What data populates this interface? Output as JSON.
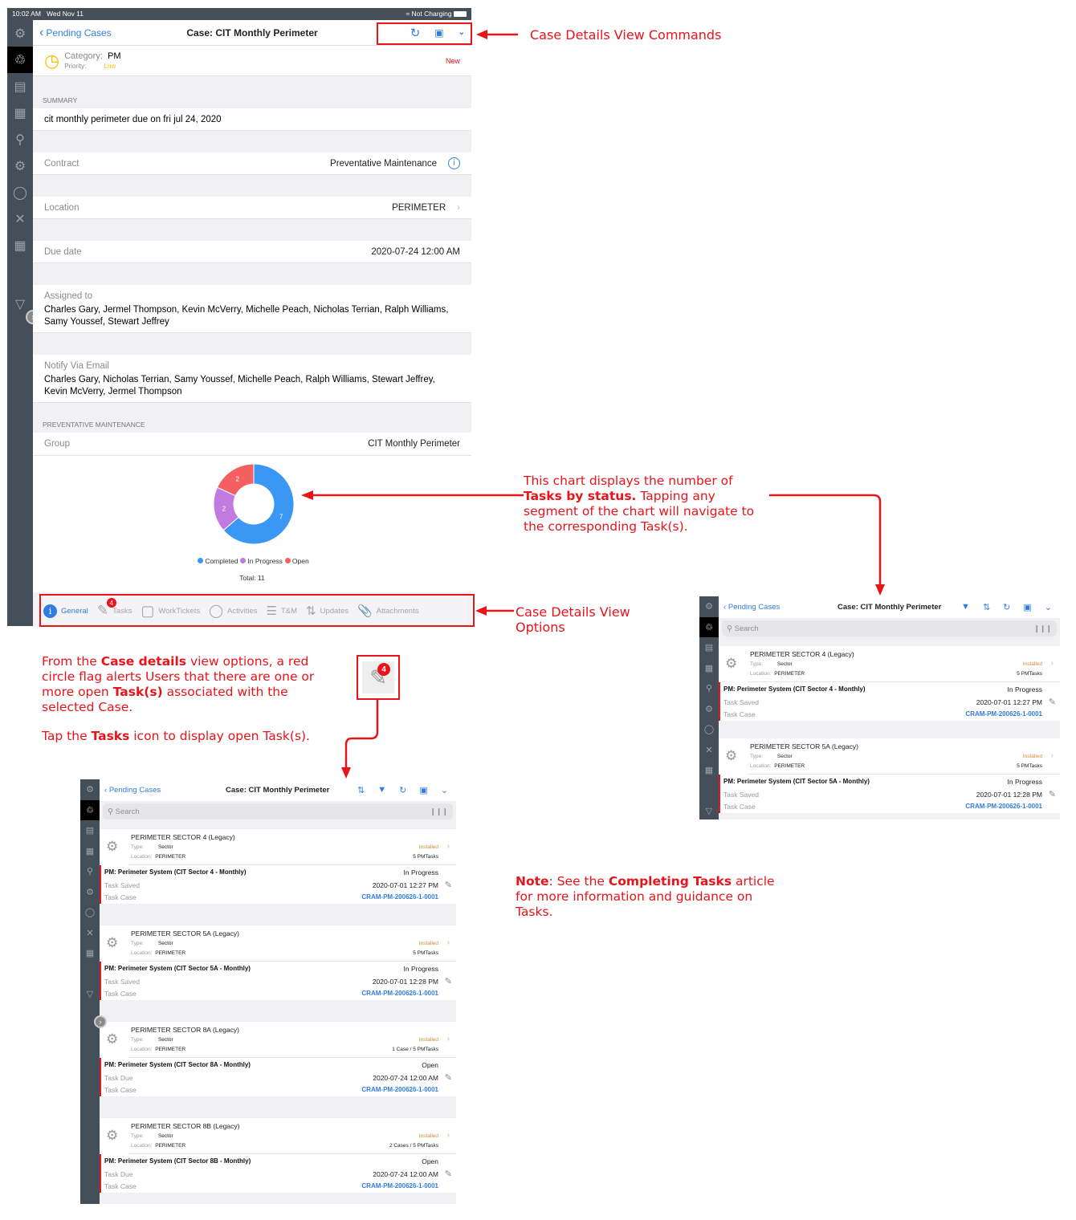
{
  "status_bar": {
    "time": "10:02 AM",
    "date": "Wed Nov 11",
    "battery": "Not Charging"
  },
  "nav": {
    "back_label": "Pending Cases",
    "title": "Case: CIT Monthly Perimeter"
  },
  "header": {
    "category_label": "Category:",
    "category_value": "PM",
    "priority_label": "Priority:",
    "priority_value": "Low",
    "status": "New"
  },
  "summary": {
    "section_label": "SUMMARY",
    "text": "cit monthly perimeter due on fri jul 24, 2020"
  },
  "fields": {
    "contract_label": "Contract",
    "contract_value": "Preventative Maintenance",
    "location_label": "Location",
    "location_value": "PERIMETER",
    "due_label": "Due date",
    "due_value": "2020-07-24 12:00 AM",
    "assigned_label": "Assigned to",
    "assigned_value": "Charles Gary, Jermel Thompson, Kevin McVerry, Michelle Peach, Nicholas Terrian, Ralph Williams, Samy Youssef, Stewart Jeffrey",
    "notify_label": "Notify Via Email",
    "notify_value": "Charles Gary, Nicholas Terrian, Samy Youssef, Michelle Peach, Ralph Williams, Stewart Jeffrey, Kevin McVerry, Jermel Thompson"
  },
  "pm": {
    "section_label": "PREVENTATIVE MAINTENANCE",
    "group_label": "Group",
    "group_value": "CIT Monthly Perimeter"
  },
  "chart_data": {
    "type": "pie",
    "title": "Tasks by status",
    "categories": [
      "Completed",
      "In Progress",
      "Open"
    ],
    "values": [
      7,
      2,
      2
    ],
    "colors": [
      "#3b97f4",
      "#c07ae0",
      "#f46060"
    ],
    "legend": "bottom",
    "total_label": "Total: 11"
  },
  "tabs": [
    {
      "label": "General",
      "selected": true
    },
    {
      "label": "Tasks",
      "badge": "4"
    },
    {
      "label": "WorkTickets"
    },
    {
      "label": "Activities"
    },
    {
      "label": "T&M"
    },
    {
      "label": "Updates"
    },
    {
      "label": "Attachments"
    }
  ],
  "annotations": {
    "commands": "Case Details View Commands",
    "options": "Case Details View Options",
    "chart_pre": "This chart displays the number of ",
    "chart_bold": "Tasks by status.",
    "chart_post": " Tapping any segment of the chart will navigate to the corresponding Task(s).",
    "flag_1": "From the ",
    "flag_b1": "Case details",
    "flag_2": " view options, a red circle flag alerts Users that there are one or more open ",
    "flag_b2": "Task(s)",
    "flag_3": " associated with the selected Case.",
    "tap_1": "Tap the ",
    "tap_b": "Tasks",
    "tap_2": " icon to display open Task(s).",
    "note_b": "Note",
    "note_1": ": See the ",
    "note_b2": "Completing Tasks",
    "note_2": " article for more information and guidance on Tasks.",
    "badge": "4"
  },
  "task_list": {
    "search_placeholder": "Search",
    "items": [
      {
        "asset": "PERIMETER SECTOR 4 (Legacy)",
        "type_label": "Type:",
        "type": "Sector",
        "loc_label": "Location:",
        "location": "PERIMETER",
        "install": "Installed",
        "count": "5 PMTasks",
        "task": "PM: Perimeter System (CIT Sector 4 - Monthly)",
        "status": "In Progress",
        "l1": "Task Saved",
        "v1": "2020-07-01 12:27 PM",
        "l2": "Task Case",
        "v2": "CRAM-PM-200626-1-0001"
      },
      {
        "asset": "PERIMETER SECTOR 5A (Legacy)",
        "type_label": "Type:",
        "type": "Sector",
        "loc_label": "Location:",
        "location": "PERIMETER",
        "install": "Installed",
        "count": "5 PMTasks",
        "task": "PM: Perimeter System (CIT Sector 5A - Monthly)",
        "status": "In Progress",
        "l1": "Task Saved",
        "v1": "2020-07-01 12:28 PM",
        "l2": "Task Case",
        "v2": "CRAM-PM-200626-1-0001"
      },
      {
        "asset": "PERIMETER SECTOR 8A (Legacy)",
        "type_label": "Type:",
        "type": "Sector",
        "loc_label": "Location:",
        "location": "PERIMETER",
        "install": "Installed",
        "count": "1 Case / 5 PMTasks",
        "task": "PM: Perimeter System (CIT Sector 8A - Monthly)",
        "status": "Open",
        "l1": "Task Due",
        "v1": "2020-07-24 12:00 AM",
        "l2": "Task Case",
        "v2": "CRAM-PM-200626-1-0001"
      },
      {
        "asset": "PERIMETER SECTOR 8B (Legacy)",
        "type_label": "Type:",
        "type": "Sector",
        "loc_label": "Location:",
        "location": "PERIMETER",
        "install": "Installed",
        "count": "2 Cases / 5 PMTasks",
        "task": "PM: Perimeter System (CIT Sector 8B - Monthly)",
        "status": "Open",
        "l1": "Task Due",
        "v1": "2020-07-24 12:00 AM",
        "l2": "Task Case",
        "v2": "CRAM-PM-200626-1-0001"
      }
    ]
  }
}
